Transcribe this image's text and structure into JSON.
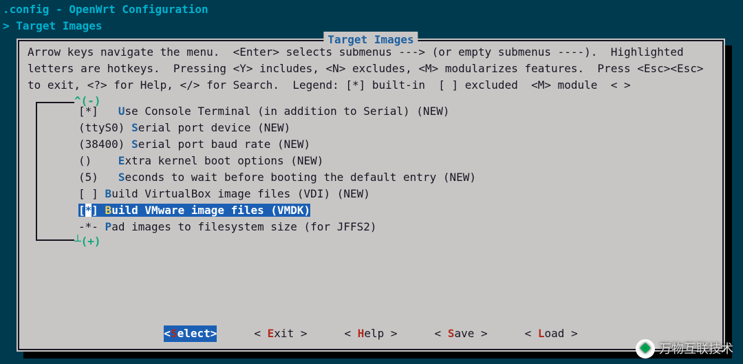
{
  "title": ".config - OpenWrt Configuration",
  "breadcrumb_prefix": ">",
  "breadcrumb": "Target Images",
  "box": {
    "title": "Target Images",
    "help": "Arrow keys navigate the menu.  <Enter> selects submenus ---> (or empty submenus ----).  Highlighted letters are hotkeys.  Pressing <Y> includes, <N> excludes, <M> modularizes features.  Press <Esc><Esc> to exit, <?> for Help, </> for Search.  Legend: [*] built-in  [ ] excluded  <M> module  < >",
    "scroll_up": "^(-)",
    "scroll_down": "┴(+)"
  },
  "items": [
    {
      "mark": "[*]",
      "hotkey": "U",
      "text": "se Console Terminal (in addition to Serial) (NEW)",
      "pad": "   "
    },
    {
      "mark": "(ttyS0)",
      "hotkey": "S",
      "text": "erial port device (NEW)",
      "pad": " "
    },
    {
      "mark": "(38400)",
      "hotkey": "S",
      "text": "erial port baud rate (NEW)",
      "pad": " "
    },
    {
      "mark": "()",
      "hotkey": "E",
      "text": "xtra kernel boot options (NEW)",
      "pad": "    "
    },
    {
      "mark": "(5)",
      "hotkey": "S",
      "text": "econds to wait before booting the default entry (NEW)",
      "pad": "   "
    },
    {
      "mark": "[ ]",
      "hotkey": "B",
      "text": "uild VirtualBox image files (VDI) (NEW)",
      "pad": " "
    },
    {
      "mark": "SEL",
      "hotkey": "B",
      "text": "uild VMware image files (VMDK)",
      "selected": true
    },
    {
      "mark": "-*-",
      "hotkey": "P",
      "text": "ad images to filesystem size (for JFFS2)",
      "pad": " "
    }
  ],
  "buttons": {
    "select": {
      "label": "Select",
      "hotkey": "S",
      "active": true
    },
    "exit": {
      "label": "xit",
      "hotkey": "E"
    },
    "help": {
      "label": "elp",
      "hotkey": "H"
    },
    "save": {
      "label": "ave",
      "hotkey": "S"
    },
    "load": {
      "label": "oad",
      "hotkey": "L"
    }
  },
  "watermark": "万物互联技术"
}
